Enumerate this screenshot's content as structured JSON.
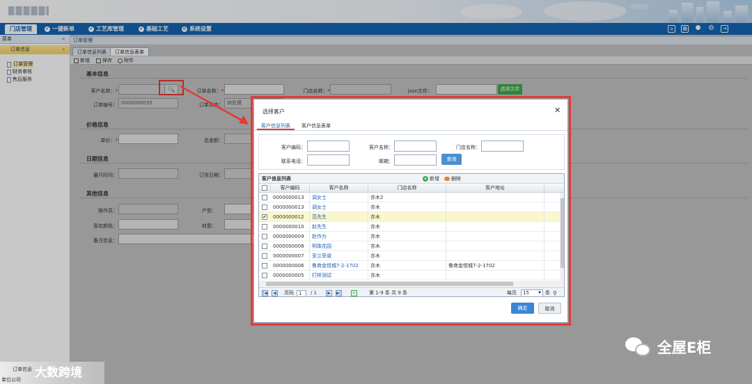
{
  "header": {
    "icons": [
      "house-icon",
      "calendar-icon",
      "user-icon",
      "gear-icon",
      "exit-icon"
    ]
  },
  "nav": {
    "items": [
      {
        "label": "门店管理",
        "icon": "store-icon"
      },
      {
        "label": "一键新单",
        "icon": "check-circle-icon"
      },
      {
        "label": "工艺库管理",
        "icon": "check-circle-icon"
      },
      {
        "label": "基础工艺",
        "icon": "check-circle-icon"
      },
      {
        "label": "系统设置",
        "icon": "settings-circle-icon"
      }
    ]
  },
  "sidebar": {
    "header": "菜单",
    "collapse": "«",
    "section": "订单信息",
    "section_toggle": "«",
    "items": [
      "订单管理",
      "财务审核",
      "售后服务"
    ]
  },
  "breadcrumb": "订单管理",
  "tabs": [
    "订单信息列表",
    "订单信息表单"
  ],
  "toolbar": {
    "new": "新增",
    "save": "保存",
    "attach": "附件"
  },
  "form": {
    "basic": "基本信息",
    "customer_name": "客户名称：",
    "order_name": "订单名称：",
    "store_name": "门店名称：",
    "json_file": "json文件：",
    "choose_file": "选择文件",
    "order_no_label": "订单编号：",
    "order_no": "0000000035",
    "order_status_label": "订单状态：",
    "order_status": "待处理",
    "price": "价格信息",
    "unit_price": "单价：",
    "total": "总金额：",
    "date": "日期信息",
    "measure_time": "量尺时间：",
    "order_date": "订货日期：",
    "other": "其他信息",
    "operator": "操作员：",
    "house_type": "户型：",
    "color": "喜欢颜色：",
    "material": "材质：",
    "remark": "备注信息："
  },
  "dialog": {
    "title": "选择客户",
    "close": "✕",
    "tabs": [
      "客户信息列表",
      "客户信息表单"
    ],
    "query": {
      "code": "客户编码：",
      "name": "客户名称：",
      "store": "门店名称：",
      "phone": "联系电话：",
      "email": "邮箱：",
      "button": "查询"
    },
    "grid_title": "客户信息列表",
    "add": "新增",
    "delete": "删除",
    "columns": [
      "客户编码",
      "客户名称",
      "门店名称",
      "客户地址"
    ],
    "rows": [
      {
        "code": "0000000013",
        "name": "调女士",
        "store": "亦木2",
        "addr": "",
        "checked": false
      },
      {
        "code": "0000000013",
        "name": "调女士",
        "store": "亦木",
        "addr": "",
        "checked": false
      },
      {
        "code": "0000000012",
        "name": "范先生",
        "store": "亦木",
        "addr": "",
        "checked": true
      },
      {
        "code": "0000000010",
        "name": "赵先生",
        "store": "亦木",
        "addr": "",
        "checked": false
      },
      {
        "code": "0000000009",
        "name": "赵作为",
        "store": "亦木",
        "addr": "",
        "checked": false
      },
      {
        "code": "0000000008",
        "name": "明珠花园",
        "store": "亦木",
        "addr": "",
        "checked": false
      },
      {
        "code": "0000000007",
        "name": "圣兰菲诺",
        "store": "亦木",
        "addr": "",
        "checked": false
      },
      {
        "code": "0000000006",
        "name": "鲁商金悦城7-2-1702",
        "store": "亦木",
        "addr": "鲁商金悦城7-2-1702",
        "checked": false
      },
      {
        "code": "0000000005",
        "name": "打样测试",
        "store": "亦木",
        "addr": "",
        "checked": false
      }
    ],
    "pager": {
      "page_label": "页码",
      "page": "1",
      "of": "/ 1",
      "range": "第 1-9 条  共 9 条",
      "per_page_label": "每页",
      "per_page": "15",
      "unit": "条"
    },
    "ok": "确定",
    "cancel": "取消"
  },
  "watermark": {
    "text": "全屋E柜",
    "corner": "大数跨境"
  },
  "footer": {
    "company": "单位公司",
    "item": "订单信息"
  },
  "colors": {
    "nav": "#1466b3",
    "highlight": "#e53935",
    "accent_btn": "#4a90d0"
  }
}
